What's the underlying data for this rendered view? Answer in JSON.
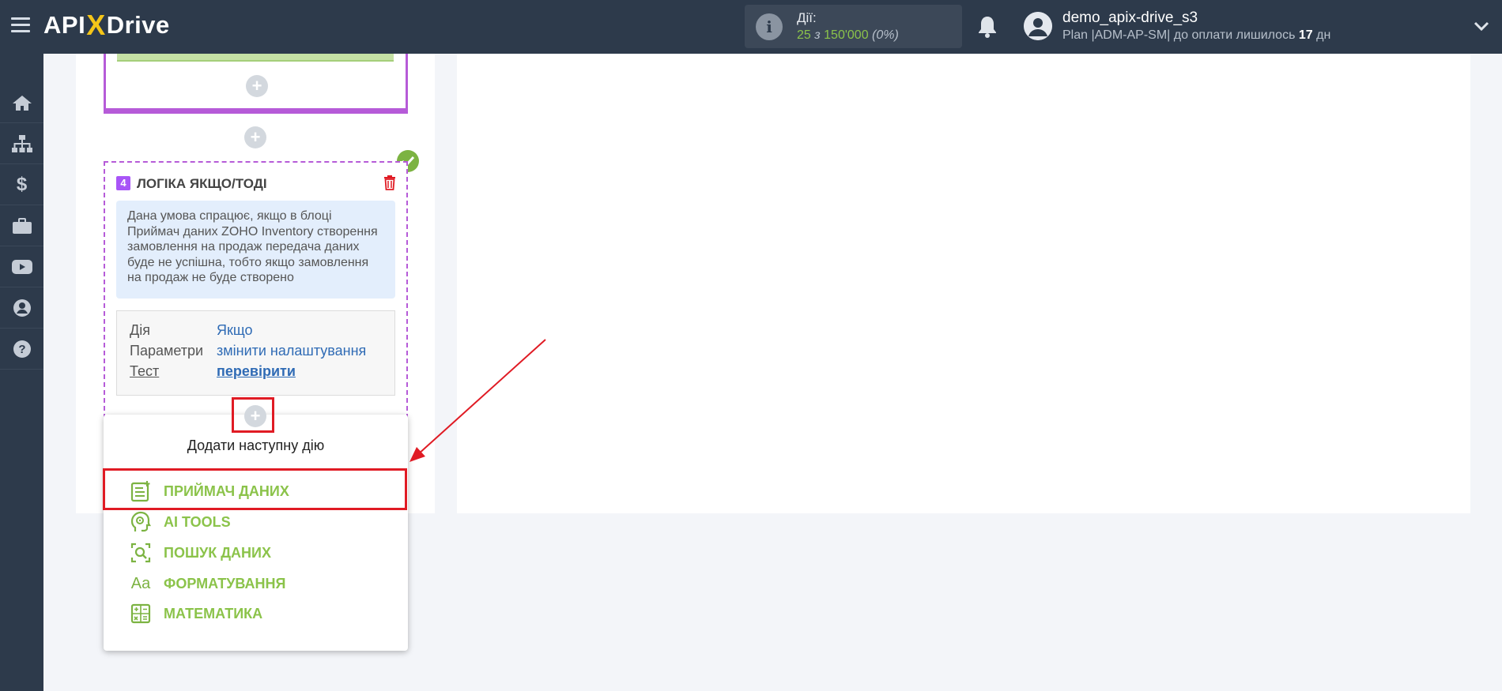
{
  "header": {
    "logo_left": "API",
    "logo_x": "X",
    "logo_right": "Drive",
    "actions_label": "Дії:",
    "actions_used": "25",
    "actions_of": "з",
    "actions_total": "150'000",
    "actions_percent": "(0%)",
    "user_name": "demo_apix-drive_s3",
    "plan_prefix": "Plan |ADM-AP-SM| до оплати лишилось",
    "plan_days": "17",
    "plan_suffix": "дн"
  },
  "sidebar": {
    "items": [
      "home-icon",
      "sitemap-icon",
      "dollar-icon",
      "briefcase-icon",
      "youtube-icon",
      "user-icon",
      "help-icon"
    ]
  },
  "logic_block": {
    "step_number": "4",
    "title": "ЛОГІКА ЯКЩО/ТОДІ",
    "description": "Дана умова спрацює, якщо в блоці Приймач даних ZOHO Inventory створення замовлення на продаж передача даних буде не успішна, тобто якщо замовлення на продаж не буде створено",
    "params": [
      {
        "label": "Дія",
        "value": "Якщо"
      },
      {
        "label": "Параметри",
        "value": "змінити налаштування"
      },
      {
        "label": "Тест",
        "value": "перевірити"
      }
    ]
  },
  "dropdown": {
    "title": "Додати наступну дію",
    "items": [
      {
        "label": "ПРИЙМАЧ ДАНИХ",
        "icon": "data-receiver-icon"
      },
      {
        "label": "AI TOOLS",
        "icon": "ai-head-icon"
      },
      {
        "label": "ПОШУК ДАНИХ",
        "icon": "search-data-icon"
      },
      {
        "label": "ФОРМАТУВАННЯ",
        "icon": "format-text-icon"
      },
      {
        "label": "МАТЕМАТИКА",
        "icon": "calculator-icon"
      }
    ]
  },
  "colors": {
    "topbar": "#2d3a4b",
    "accent_green": "#8bc34a",
    "accent_purple": "#b65bd8",
    "highlight_red": "#e01b24",
    "link_blue": "#2f6bb5"
  }
}
